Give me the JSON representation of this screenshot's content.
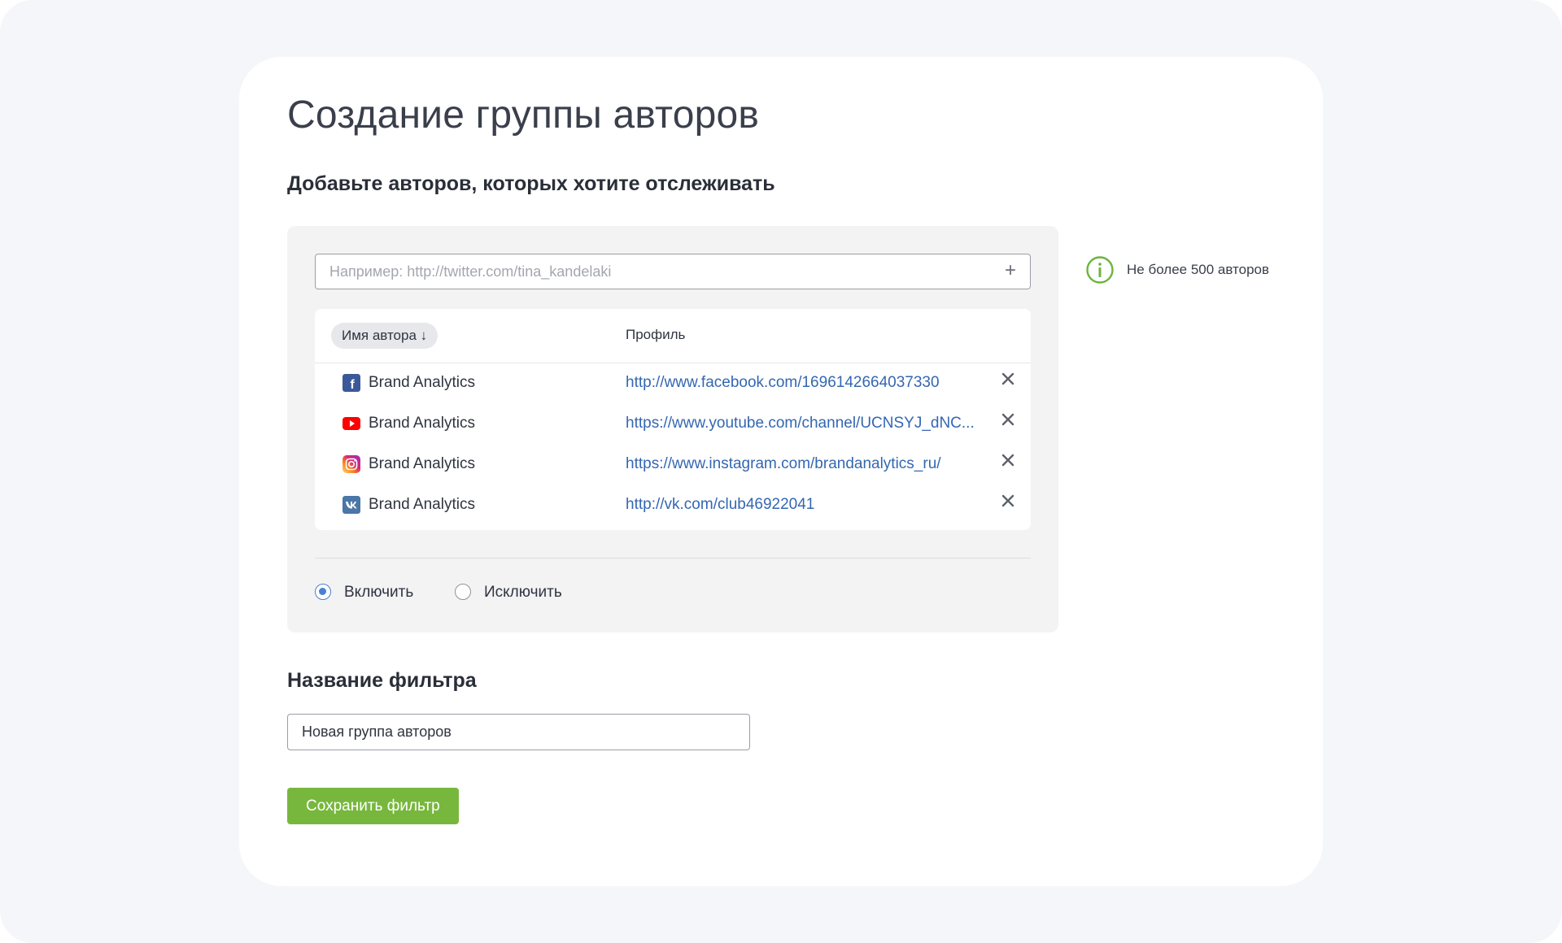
{
  "page": {
    "title": "Создание группы авторов",
    "section_title": "Добавьте авторов, которых хотите отслеживать"
  },
  "author_input": {
    "placeholder": "Например: http://twitter.com/tina_kandelaki",
    "add_icon": "plus-icon"
  },
  "table": {
    "sort_label": "Имя автора ↓",
    "profile_header": "Профиль",
    "rows": [
      {
        "network": "facebook",
        "icon": "facebook-icon",
        "name": "Brand Analytics",
        "profile": "http://www.facebook.com/1696142664037330"
      },
      {
        "network": "youtube",
        "icon": "youtube-icon",
        "name": "Brand Analytics",
        "profile": "https://www.youtube.com/channel/UCNSYJ_dNC..."
      },
      {
        "network": "instagram",
        "icon": "instagram-icon",
        "name": "Brand Analytics",
        "profile": "https://www.instagram.com/brandanalytics_ru/"
      },
      {
        "network": "vk",
        "icon": "vk-icon",
        "name": "Brand Analytics",
        "profile": "http://vk.com/club46922041"
      }
    ]
  },
  "mode": {
    "include_label": "Включить",
    "exclude_label": "Исключить",
    "selected": "include"
  },
  "info": {
    "text": "Не более 500 авторов",
    "icon": "info-icon"
  },
  "filter": {
    "title": "Название фильтра",
    "name_value": "Новая группа авторов"
  },
  "save_button": "Сохранить фильтр",
  "colors": {
    "accent_green": "#78b73d",
    "link_blue": "#3467b1",
    "radio_blue": "#4a7fd4",
    "info_green": "#6cb33f",
    "facebook": "#3b5998",
    "youtube": "#ff0000",
    "vk": "#4a76a8"
  }
}
